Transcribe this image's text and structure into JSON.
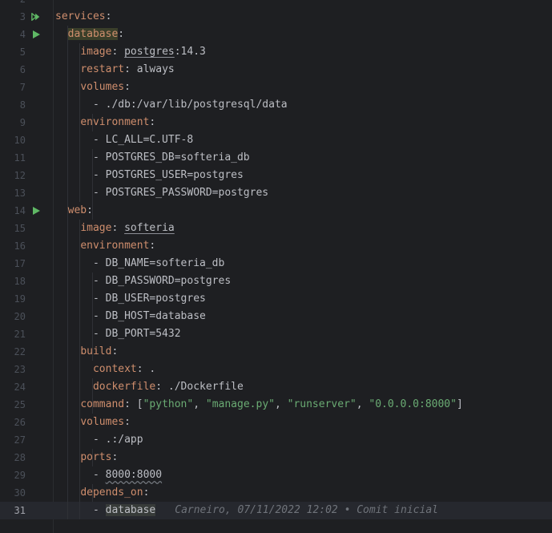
{
  "editor": {
    "lines": [
      {
        "n": "2",
        "segs": []
      },
      {
        "n": "3",
        "run": "double",
        "segs": [
          {
            "t": "services",
            "c": "k"
          },
          {
            "t": ":",
            "c": "p"
          }
        ]
      },
      {
        "n": "4",
        "run": "single",
        "segs": [
          {
            "t": "  "
          },
          {
            "t": "database",
            "c": "k hl-db"
          },
          {
            "t": ":",
            "c": "p"
          }
        ]
      },
      {
        "n": "5",
        "segs": [
          {
            "t": "    "
          },
          {
            "t": "image",
            "c": "k"
          },
          {
            "t": ": ",
            "c": "p"
          },
          {
            "t": "postgres",
            "c": "v ul"
          },
          {
            "t": ":14.3",
            "c": "v"
          }
        ]
      },
      {
        "n": "6",
        "segs": [
          {
            "t": "    "
          },
          {
            "t": "restart",
            "c": "k"
          },
          {
            "t": ": ",
            "c": "p"
          },
          {
            "t": "always",
            "c": "v"
          }
        ]
      },
      {
        "n": "7",
        "segs": [
          {
            "t": "    "
          },
          {
            "t": "volumes",
            "c": "k"
          },
          {
            "t": ":",
            "c": "p"
          }
        ]
      },
      {
        "n": "8",
        "segs": [
          {
            "t": "      "
          },
          {
            "t": "- ./db:/var/lib/postgresql/data",
            "c": "v"
          }
        ]
      },
      {
        "n": "9",
        "segs": [
          {
            "t": "    "
          },
          {
            "t": "environment",
            "c": "k"
          },
          {
            "t": ":",
            "c": "p"
          }
        ]
      },
      {
        "n": "10",
        "segs": [
          {
            "t": "      "
          },
          {
            "t": "- LC_ALL=C.UTF-8",
            "c": "v"
          }
        ]
      },
      {
        "n": "11",
        "segs": [
          {
            "t": "      "
          },
          {
            "t": "- POSTGRES_DB=softeria_db",
            "c": "v"
          }
        ]
      },
      {
        "n": "12",
        "segs": [
          {
            "t": "      "
          },
          {
            "t": "- POSTGRES_USER=postgres",
            "c": "v"
          }
        ]
      },
      {
        "n": "13",
        "segs": [
          {
            "t": "      "
          },
          {
            "t": "- POSTGRES_PASSWORD=postgres",
            "c": "v"
          }
        ]
      },
      {
        "n": "14",
        "run": "single",
        "segs": [
          {
            "t": "  "
          },
          {
            "t": "web",
            "c": "k"
          },
          {
            "t": ":",
            "c": "p"
          }
        ]
      },
      {
        "n": "15",
        "segs": [
          {
            "t": "    "
          },
          {
            "t": "image",
            "c": "k"
          },
          {
            "t": ": ",
            "c": "p"
          },
          {
            "t": "softeria",
            "c": "v ul"
          }
        ]
      },
      {
        "n": "16",
        "segs": [
          {
            "t": "    "
          },
          {
            "t": "environment",
            "c": "k"
          },
          {
            "t": ":",
            "c": "p"
          }
        ]
      },
      {
        "n": "17",
        "segs": [
          {
            "t": "      "
          },
          {
            "t": "- DB_NAME=softeria_db",
            "c": "v"
          }
        ]
      },
      {
        "n": "18",
        "segs": [
          {
            "t": "      "
          },
          {
            "t": "- DB_PASSWORD=postgres",
            "c": "v"
          }
        ]
      },
      {
        "n": "19",
        "segs": [
          {
            "t": "      "
          },
          {
            "t": "- DB_USER=postgres",
            "c": "v"
          }
        ]
      },
      {
        "n": "20",
        "segs": [
          {
            "t": "      "
          },
          {
            "t": "- DB_HOST=database",
            "c": "v"
          }
        ]
      },
      {
        "n": "21",
        "segs": [
          {
            "t": "      "
          },
          {
            "t": "- DB_PORT=5432",
            "c": "v"
          }
        ]
      },
      {
        "n": "22",
        "segs": [
          {
            "t": "    "
          },
          {
            "t": "build",
            "c": "k"
          },
          {
            "t": ":",
            "c": "p"
          }
        ]
      },
      {
        "n": "23",
        "segs": [
          {
            "t": "      "
          },
          {
            "t": "context",
            "c": "k"
          },
          {
            "t": ": ",
            "c": "p"
          },
          {
            "t": ".",
            "c": "v"
          }
        ]
      },
      {
        "n": "24",
        "segs": [
          {
            "t": "      "
          },
          {
            "t": "dockerfile",
            "c": "k"
          },
          {
            "t": ": ",
            "c": "p"
          },
          {
            "t": "./Dockerfile",
            "c": "v"
          }
        ]
      },
      {
        "n": "25",
        "segs": [
          {
            "t": "    "
          },
          {
            "t": "command",
            "c": "k"
          },
          {
            "t": ": [",
            "c": "p"
          },
          {
            "t": "\"python\"",
            "c": "s"
          },
          {
            "t": ", ",
            "c": "p"
          },
          {
            "t": "\"manage.py\"",
            "c": "s"
          },
          {
            "t": ", ",
            "c": "p"
          },
          {
            "t": "\"runserver\"",
            "c": "s"
          },
          {
            "t": ", ",
            "c": "p"
          },
          {
            "t": "\"0.0.0.0:8000\"",
            "c": "s"
          },
          {
            "t": "]",
            "c": "p"
          }
        ]
      },
      {
        "n": "26",
        "segs": [
          {
            "t": "    "
          },
          {
            "t": "volumes",
            "c": "k"
          },
          {
            "t": ":",
            "c": "p"
          }
        ]
      },
      {
        "n": "27",
        "segs": [
          {
            "t": "      "
          },
          {
            "t": "- .:/app",
            "c": "v"
          }
        ]
      },
      {
        "n": "28",
        "segs": [
          {
            "t": "    "
          },
          {
            "t": "ports",
            "c": "k"
          },
          {
            "t": ":",
            "c": "p"
          }
        ]
      },
      {
        "n": "29",
        "segs": [
          {
            "t": "      "
          },
          {
            "t": "- ",
            "c": "v"
          },
          {
            "t": "8000:8000",
            "c": "v wavy"
          }
        ]
      },
      {
        "n": "30",
        "segs": [
          {
            "t": "    "
          },
          {
            "t": "depends_on",
            "c": "k"
          },
          {
            "t": ":",
            "c": "p"
          }
        ]
      },
      {
        "n": "31",
        "current": true,
        "segs": [
          {
            "t": "      "
          },
          {
            "t": "- ",
            "c": "v"
          },
          {
            "t": "database",
            "c": "v hl-ref"
          }
        ],
        "blame": "Carneiro, 07/11/2022 12:02 • Comit inicial"
      }
    ]
  },
  "icons": {
    "run_double": "run-all-icon",
    "run_single": "run-icon"
  },
  "colors": {
    "background": "#1e1f22",
    "key": "#cf8e6d",
    "string": "#6aab73",
    "run": "#5fb865"
  }
}
